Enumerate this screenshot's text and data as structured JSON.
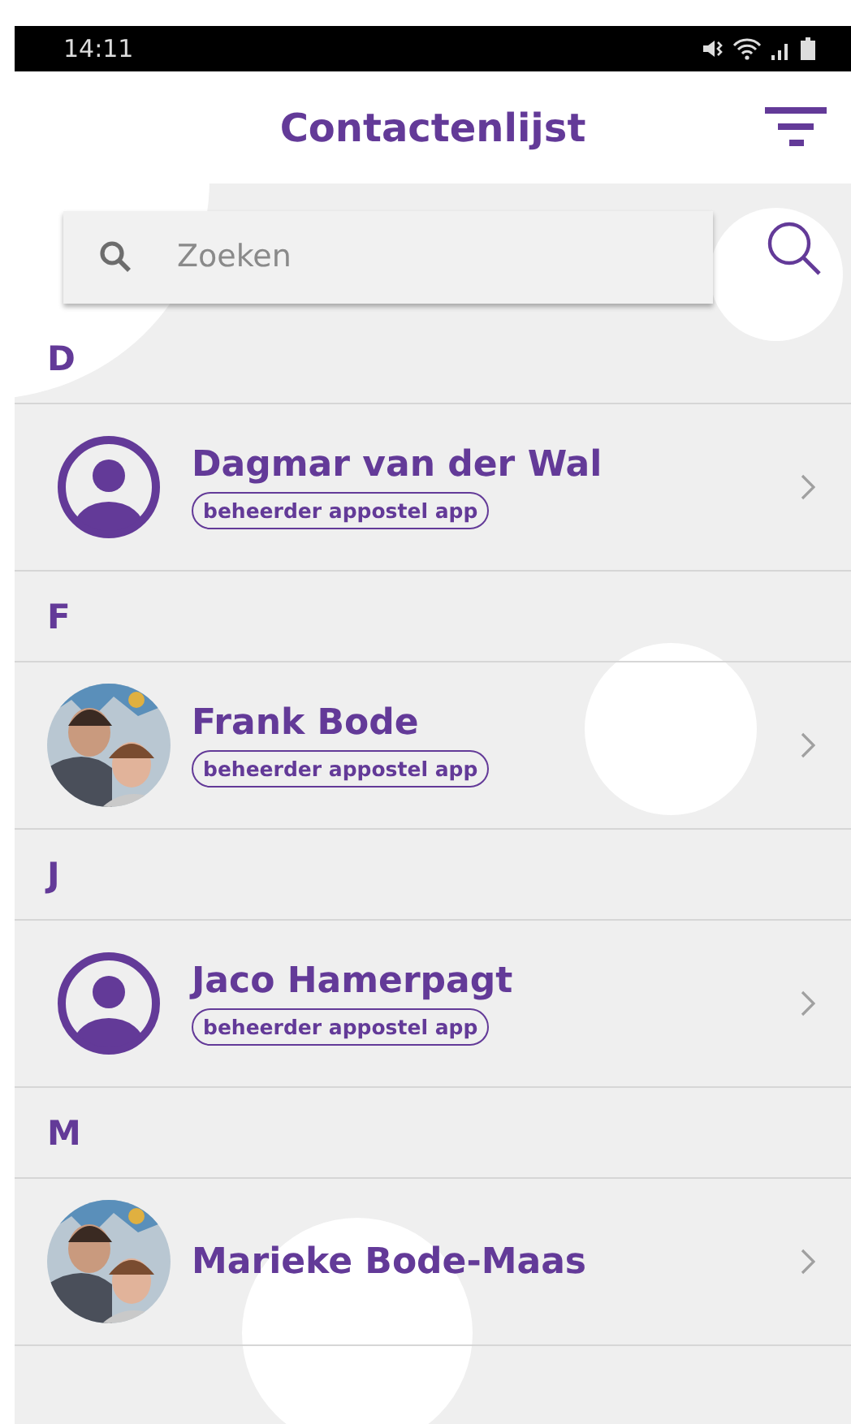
{
  "status_bar": {
    "time": "14:11"
  },
  "header": {
    "title": "Contactenlijst"
  },
  "search": {
    "placeholder": "Zoeken"
  },
  "sections": [
    {
      "letter": "D",
      "contacts": [
        {
          "name": "Dagmar van der Wal",
          "avatar": {
            "kind": "placeholder"
          },
          "role": "beheerder appostel app"
        }
      ]
    },
    {
      "letter": "F",
      "contacts": [
        {
          "name": "Frank Bode",
          "role": "beheerder appostel app"
        }
      ]
    },
    {
      "letter": "J",
      "contacts": [
        {
          "name": "Jaco Hamerpagt",
          "avatar": {
            "kind": "placeholder"
          },
          "role": "beheerder appostel app"
        }
      ]
    },
    {
      "letter": "M",
      "contacts": [
        {
          "name": "Marieke Bode-Maas"
        }
      ]
    }
  ]
}
